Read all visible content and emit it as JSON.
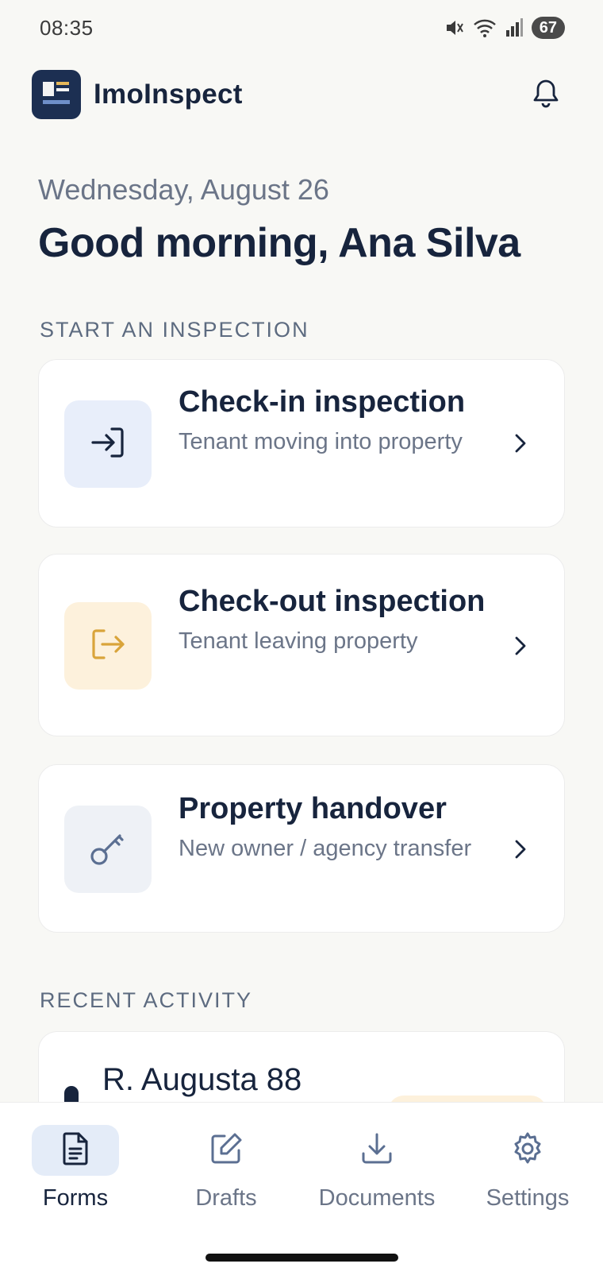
{
  "status_bar": {
    "time": "08:35",
    "battery": "67",
    "icons": [
      "mute-icon",
      "wifi-icon",
      "signal-icon"
    ]
  },
  "app": {
    "name": "ImoInspect",
    "notifications_icon": "bell-icon"
  },
  "greeting": {
    "date": "Wednesday, August 26",
    "text": "Good morning, Ana Silva"
  },
  "sections": {
    "start": "START AN INSPECTION",
    "recent": "RECENT ACTIVITY"
  },
  "inspections": [
    {
      "title": "Check-in inspection",
      "subtitle": "Tenant moving into property",
      "icon": "login-arrow-icon",
      "color": "#17243d"
    },
    {
      "title": "Check-out inspection",
      "subtitle": "Tenant leaving property",
      "icon": "logout-arrow-icon",
      "color": "#d9a43a"
    },
    {
      "title": "Property handover",
      "subtitle": "New owner / agency transfer",
      "icon": "key-icon",
      "color": "#5b6f92"
    }
  ],
  "recent": [
    {
      "title": "R. Augusta 88"
    }
  ],
  "nav": [
    {
      "label": "Forms",
      "icon": "document-icon",
      "active": true
    },
    {
      "label": "Drafts",
      "icon": "edit-icon",
      "active": false
    },
    {
      "label": "Documents",
      "icon": "download-icon",
      "active": false
    },
    {
      "label": "Settings",
      "icon": "gear-icon",
      "active": false
    }
  ],
  "colors": {
    "background": "#f8f8f5",
    "primary": "#17243d",
    "accent": "#e6b85a",
    "muted": "#6b7588"
  }
}
